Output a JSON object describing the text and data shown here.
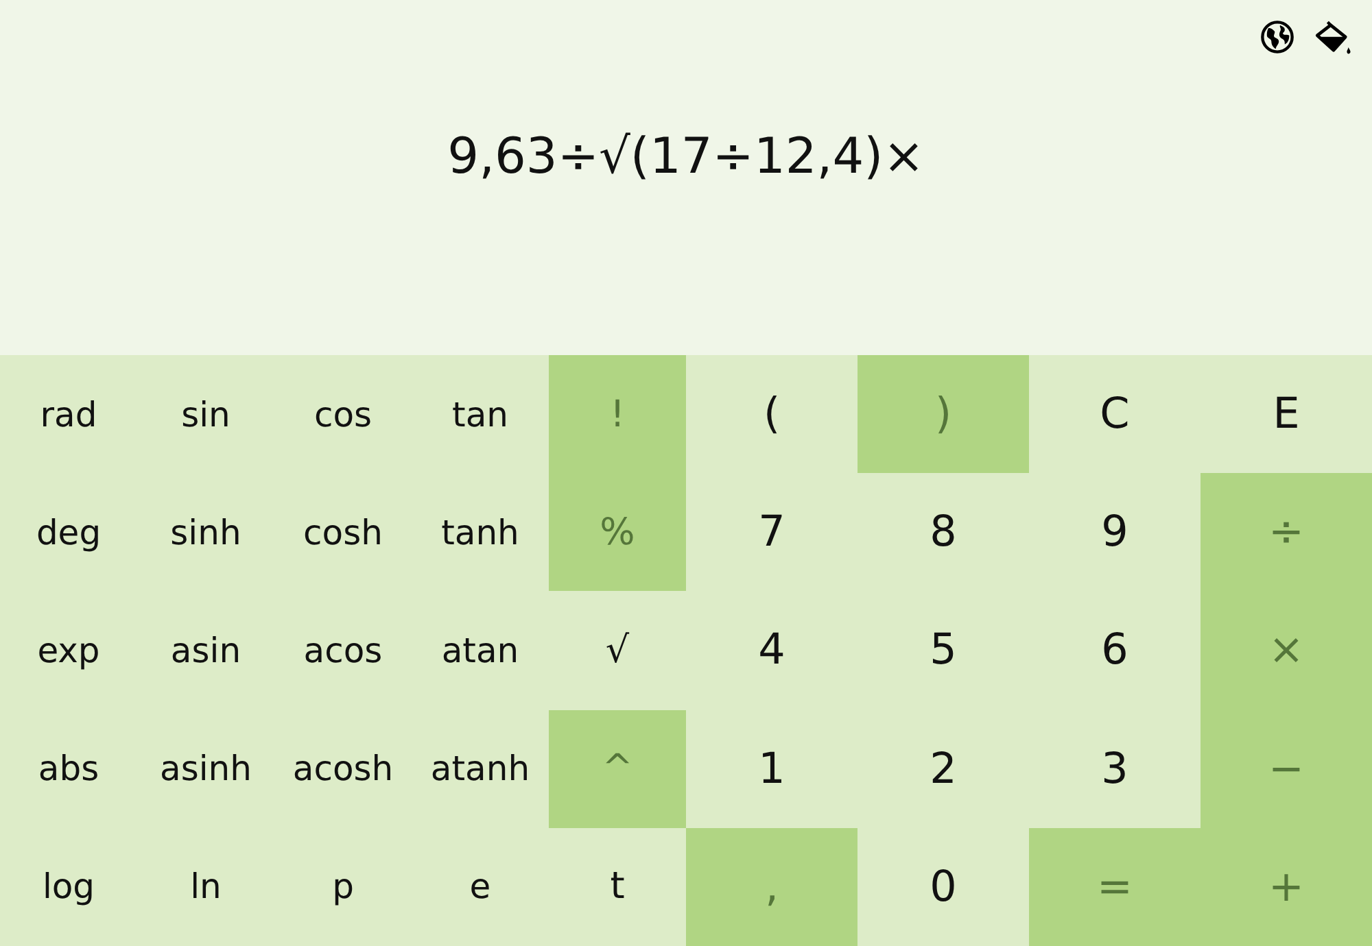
{
  "display": {
    "expression": "9,63÷√(17÷12,4)×"
  },
  "keys": [
    {
      "label": "rad",
      "kind": "function",
      "disabled": false
    },
    {
      "label": "sin",
      "kind": "function",
      "disabled": false
    },
    {
      "label": "cos",
      "kind": "function",
      "disabled": false
    },
    {
      "label": "tan",
      "kind": "function",
      "disabled": false
    },
    {
      "label": "!",
      "kind": "operator",
      "disabled": true
    },
    {
      "label": "(",
      "kind": "digit",
      "disabled": false
    },
    {
      "label": ")",
      "kind": "digit",
      "disabled": true
    },
    {
      "label": "C",
      "kind": "digit",
      "disabled": false
    },
    {
      "label": "E",
      "kind": "digit",
      "disabled": false
    },
    {
      "label": "deg",
      "kind": "function",
      "disabled": false
    },
    {
      "label": "sinh",
      "kind": "function",
      "disabled": false
    },
    {
      "label": "cosh",
      "kind": "function",
      "disabled": false
    },
    {
      "label": "tanh",
      "kind": "function",
      "disabled": false
    },
    {
      "label": "%",
      "kind": "operator",
      "disabled": true
    },
    {
      "label": "7",
      "kind": "digit",
      "disabled": false
    },
    {
      "label": "8",
      "kind": "digit",
      "disabled": false
    },
    {
      "label": "9",
      "kind": "digit",
      "disabled": false
    },
    {
      "label": "÷",
      "kind": "digit",
      "disabled": true
    },
    {
      "label": "exp",
      "kind": "function",
      "disabled": false
    },
    {
      "label": "asin",
      "kind": "function",
      "disabled": false
    },
    {
      "label": "acos",
      "kind": "function",
      "disabled": false
    },
    {
      "label": "atan",
      "kind": "function",
      "disabled": false
    },
    {
      "label": "√",
      "kind": "operator",
      "disabled": false
    },
    {
      "label": "4",
      "kind": "digit",
      "disabled": false
    },
    {
      "label": "5",
      "kind": "digit",
      "disabled": false
    },
    {
      "label": "6",
      "kind": "digit",
      "disabled": false
    },
    {
      "label": "×",
      "kind": "digit",
      "disabled": true
    },
    {
      "label": "abs",
      "kind": "function",
      "disabled": false
    },
    {
      "label": "asinh",
      "kind": "function",
      "disabled": false
    },
    {
      "label": "acosh",
      "kind": "function",
      "disabled": false
    },
    {
      "label": "atanh",
      "kind": "function",
      "disabled": false
    },
    {
      "label": "^",
      "kind": "operator",
      "disabled": true
    },
    {
      "label": "1",
      "kind": "digit",
      "disabled": false
    },
    {
      "label": "2",
      "kind": "digit",
      "disabled": false
    },
    {
      "label": "3",
      "kind": "digit",
      "disabled": false
    },
    {
      "label": "−",
      "kind": "digit",
      "disabled": true
    },
    {
      "label": "log",
      "kind": "function",
      "disabled": false
    },
    {
      "label": "ln",
      "kind": "function",
      "disabled": false
    },
    {
      "label": "p",
      "kind": "function",
      "disabled": false
    },
    {
      "label": "e",
      "kind": "function",
      "disabled": false
    },
    {
      "label": "t",
      "kind": "operator",
      "disabled": false
    },
    {
      "label": ",",
      "kind": "digit",
      "disabled": true
    },
    {
      "label": "0",
      "kind": "digit",
      "disabled": false
    },
    {
      "label": "=",
      "kind": "digit",
      "disabled": true
    },
    {
      "label": "+",
      "kind": "digit",
      "disabled": true
    }
  ]
}
